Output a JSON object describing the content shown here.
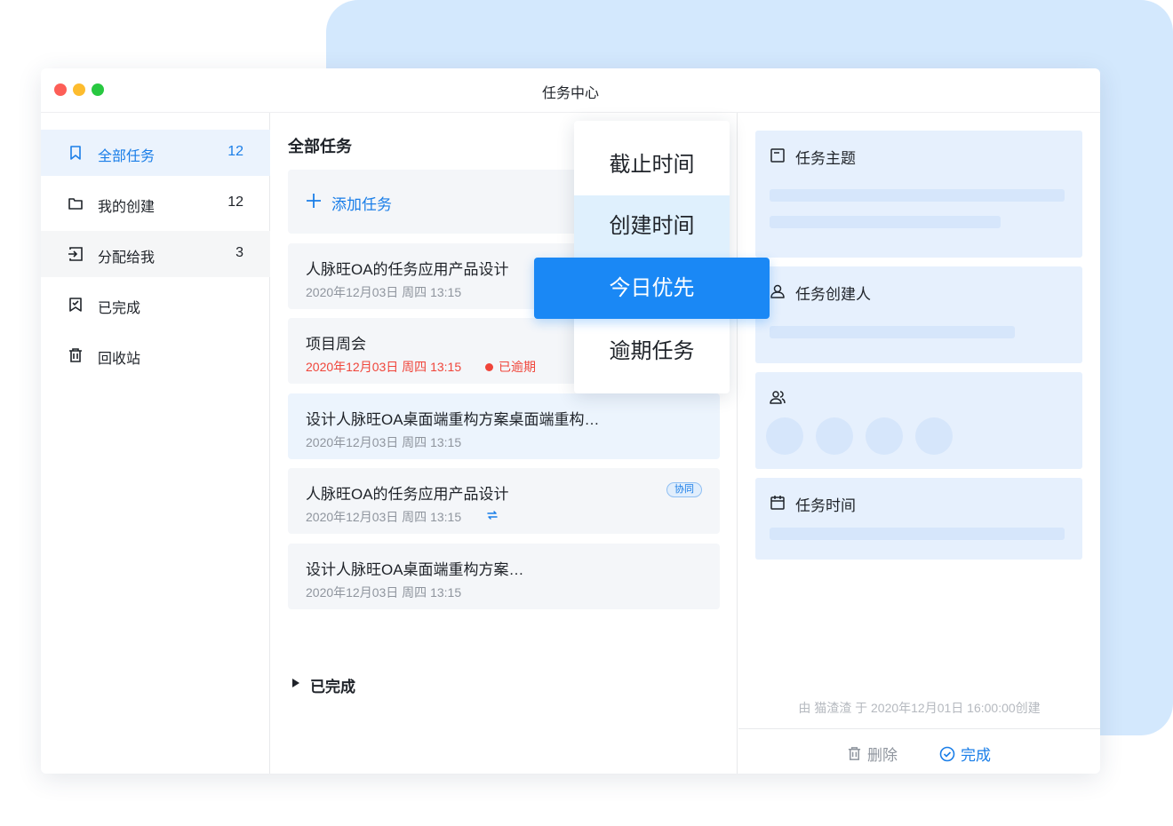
{
  "window": {
    "title": "任务中心"
  },
  "sidebar": {
    "items": [
      {
        "label": "全部任务",
        "count": "12",
        "icon": "bookmark-icon"
      },
      {
        "label": "我的创建",
        "count": "12",
        "icon": "folder-icon"
      },
      {
        "label": "分配给我",
        "count": "3",
        "icon": "assign-icon"
      },
      {
        "label": "已完成",
        "count": "",
        "icon": "bookmark-check-icon"
      },
      {
        "label": "回收站",
        "count": "",
        "icon": "trash-icon"
      }
    ]
  },
  "list": {
    "title": "全部任务",
    "add_label": "添加任务",
    "tasks": [
      {
        "title": "人脉旺OA的任务应用产品设计",
        "date": "2020年12月03日 周四 13:15"
      },
      {
        "title": "项目周会",
        "date": "2020年12月03日 周四 13:15",
        "status": "已逾期"
      },
      {
        "title": "设计人脉旺OA桌面端重构方案桌面端重构…",
        "date": "2020年12月03日 周四 13:15"
      },
      {
        "title": "人脉旺OA的任务应用产品设计",
        "date": "2020年12月03日 周四 13:15",
        "tag": "协同"
      },
      {
        "title": "设计人脉旺OA桌面端重构方案…",
        "date": "2020年12月03日 周四 13:15"
      }
    ],
    "completed_label": "已完成"
  },
  "detail": {
    "subject_label": "任务主题",
    "creator_label": "任务创建人",
    "time_label": "任务时间",
    "meta": "由 猫渣渣 于 2020年12月01日 16:00:00创建",
    "delete_label": "删除",
    "complete_label": "完成"
  },
  "sort_menu": {
    "options": [
      "截止时间",
      "创建时间",
      "今日优先",
      "逾期任务"
    ],
    "selected": "今日优先"
  },
  "colors": {
    "accent": "#1a88f5",
    "danger": "#f0453a",
    "background_card": "#d3e8fd"
  }
}
